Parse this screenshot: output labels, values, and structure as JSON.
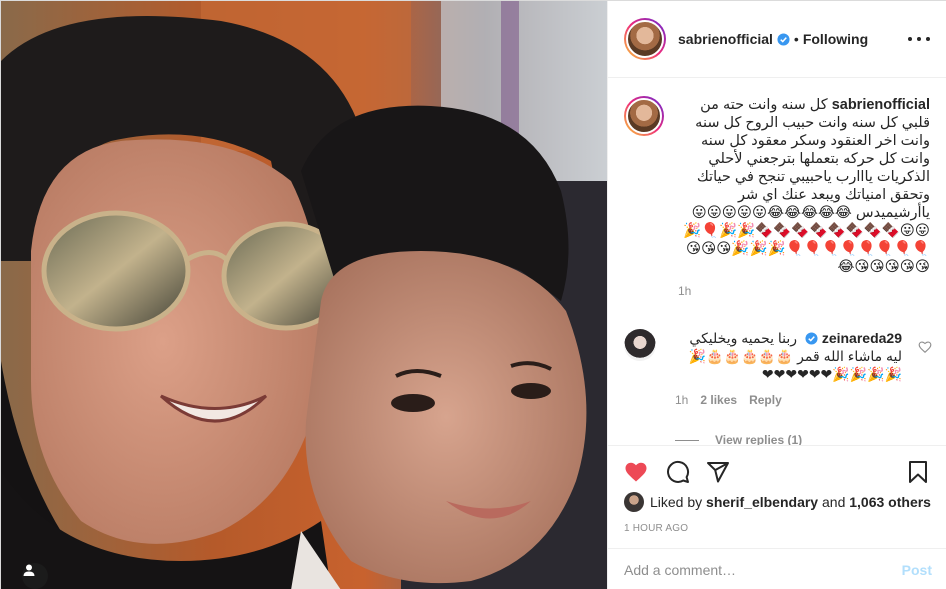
{
  "post": {
    "username": "sabrienofficial",
    "follow_status": "Following",
    "separator": "•"
  },
  "caption": {
    "username": "sabrienofficial",
    "text": "كل سنه وانت حته من قلبي كل سنه وانت حبيب الروح كل سنه وانت اخر العنقود وسكر معقود كل سنه وانت كل حركه بتعملها بترجعني لأحلي الذكريات يااارب ياحبيبي تنجح في حياتك وتحقق امنياتك ويبعد عنك اي شر ياأرشيميدس",
    "emojis": "😂😂😂😂😂😛😛😛😛😛😛😛🍫🍫🍫🍫🍫🍫🍫🍫🎉🎉🎈🎉🎈🎈🎈🎈🎈🎈🎈🎈🎉🎉🎉😘😘😘😘😘😘😘😘😂",
    "time": "1h"
  },
  "comment": {
    "username": "zeinareda29",
    "text": "ربنا يحميه ويخليكي ليه ماشاء الله قمر",
    "emojis": "🎂🎂🎂🎂🎂🎉🎉🎉🎉🎉❤❤❤❤❤❤",
    "time": "1h",
    "likes": "2 likes",
    "reply_label": "Reply",
    "view_replies": "View replies (1)"
  },
  "likes": {
    "prefix": "Liked by",
    "user": "sherif_elbendary",
    "conjunction": "and",
    "others": "1,063 others"
  },
  "post_time": "1 HOUR AGO",
  "add_comment": {
    "placeholder": "Add a comment…",
    "post_label": "Post"
  },
  "colors": {
    "like_red": "#ed4956",
    "verified_blue": "#3897f0",
    "post_disabled": "#b2dffc"
  }
}
